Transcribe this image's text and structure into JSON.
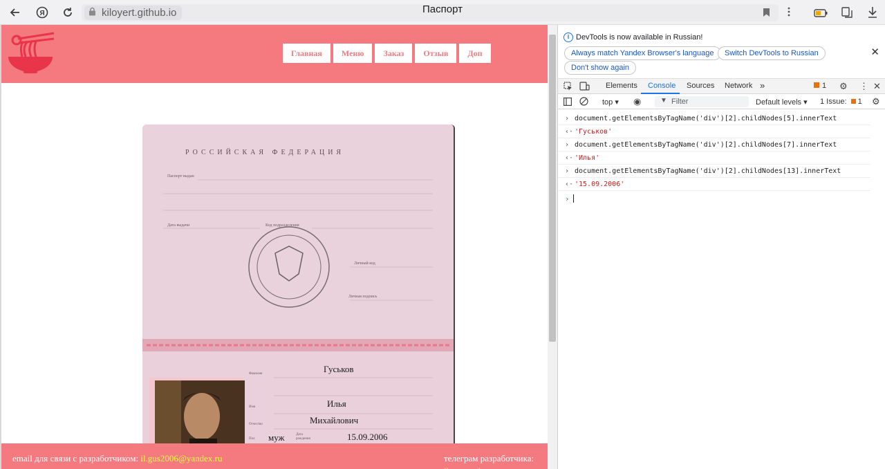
{
  "browser": {
    "url": "kiloyert.github.io",
    "page_title": "Паспорт"
  },
  "site": {
    "nav": [
      "Главная",
      "Меню",
      "Заказ",
      "Отзыв",
      "Доп"
    ],
    "footer": {
      "email_label": "email для связи с разработчиком:",
      "email": "il.gus2006@yandex.ru",
      "telegram_label": "телеграм разработчика:",
      "telegram_handle": "ilya_gusek"
    },
    "colors": {
      "accent": "#f47a80",
      "link": "#e9ff3c"
    }
  },
  "passport": {
    "country": "РОССИЙСКАЯ ФЕДЕРАЦИЯ",
    "labels": {
      "issued_by": "Паспорт выдан",
      "issue_date": "Дата выдачи",
      "division_code": "Код подразделения",
      "personal_code": "Личный код",
      "personal_signature": "Личная подпись",
      "surname": "Фамилия",
      "name": "Имя",
      "patronymic": "Отчество",
      "sex": "Пол",
      "birth_date": "Дата рождения"
    },
    "surname": "Гуськов",
    "name": "Илья",
    "patronymic": "Михайлович",
    "sex": "муж",
    "birth_date": "15.09.2006"
  },
  "devtools": {
    "info_text": "DevTools is now available in Russian!",
    "buttons": [
      "Always match Yandex Browser's language",
      "Switch DevTools to Russian",
      "Don't show again"
    ],
    "tabs": [
      "Elements",
      "Console",
      "Sources",
      "Network"
    ],
    "issues_badge": "1",
    "context": "top",
    "filter_placeholder": "Filter",
    "levels": "Default levels",
    "issues_count": "1 Issue:",
    "issues_count_badge": "1",
    "console": [
      {
        "type": "input",
        "text": "document.getElementsByTagName('div')[2].childNodes[5].innerText"
      },
      {
        "type": "output",
        "text": "'Гуськов'"
      },
      {
        "type": "input",
        "text": "document.getElementsByTagName('div')[2].childNodes[7].innerText"
      },
      {
        "type": "output",
        "text": "'Илья'"
      },
      {
        "type": "input",
        "text": "document.getElementsByTagName('div')[2].childNodes[13].innerText"
      },
      {
        "type": "output",
        "text": "'15.09.2006'"
      }
    ]
  }
}
